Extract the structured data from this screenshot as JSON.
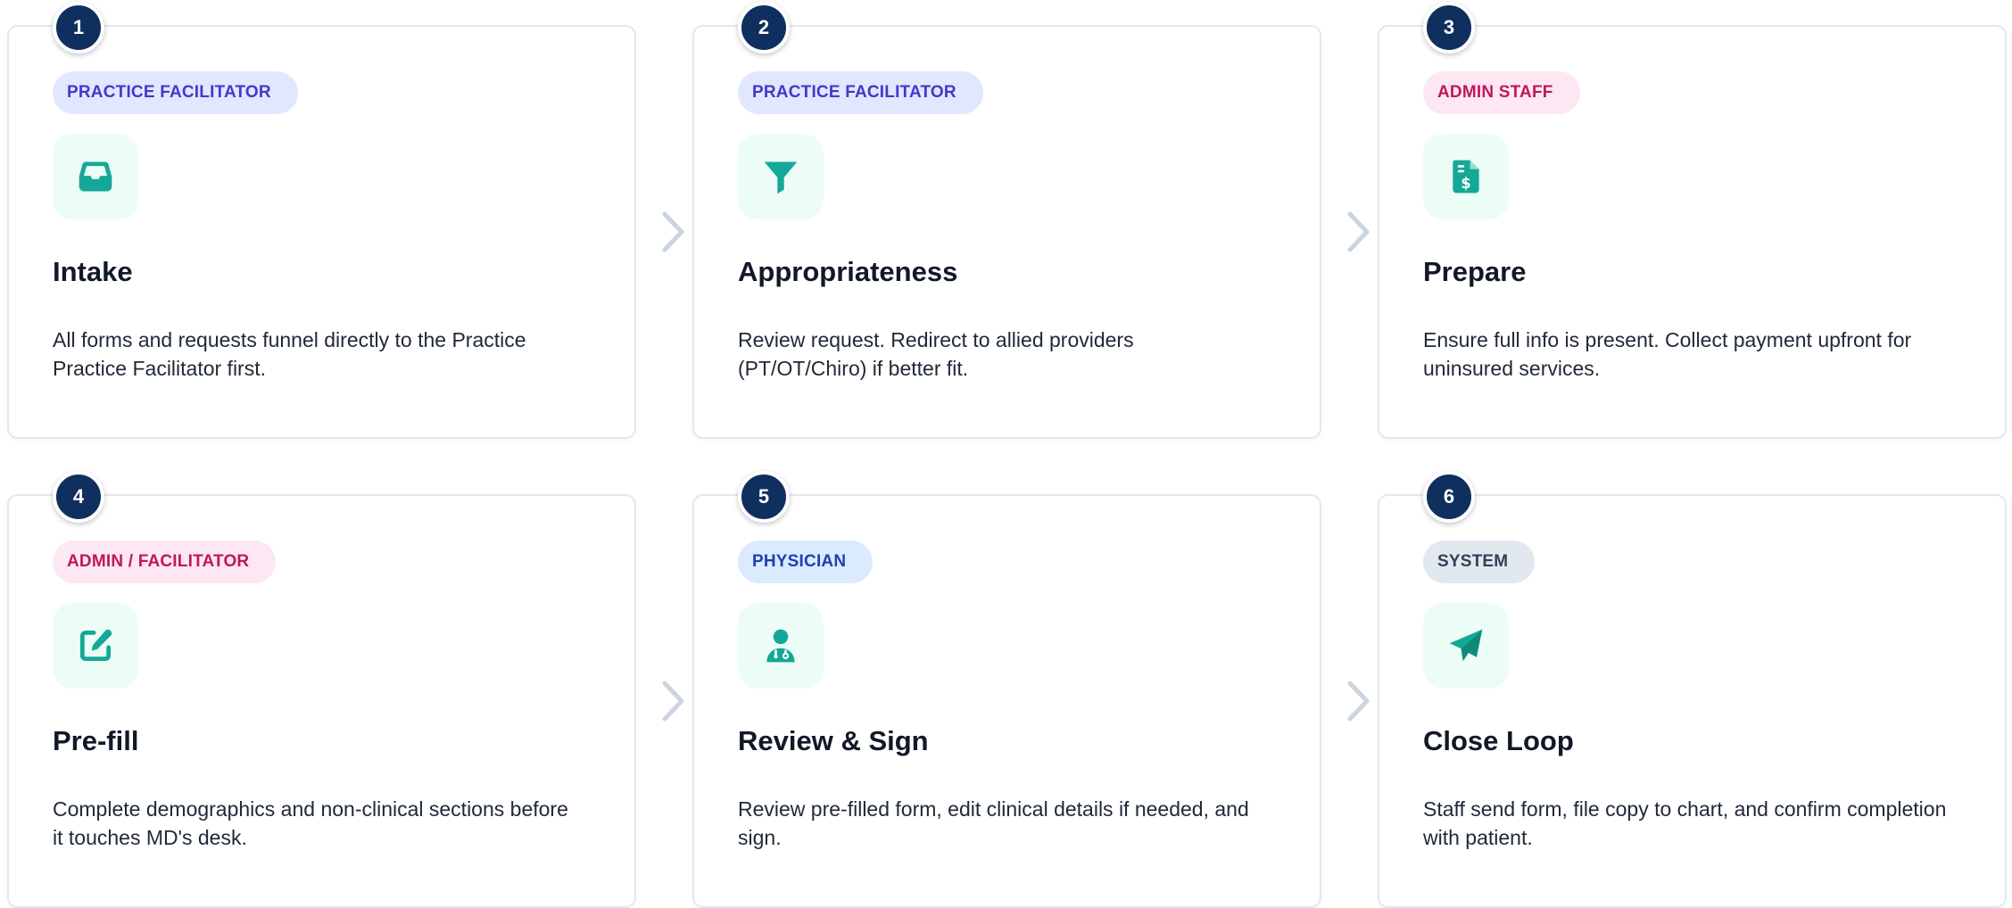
{
  "colors": {
    "number_circle": "#0f2f5f",
    "icon_teal": "#14a896",
    "icon_tile_bg": "#ecfdf8",
    "arrow": "#cbd5e1"
  },
  "steps": [
    {
      "number": "1",
      "role": "PRACTICE FACILITATOR",
      "role_style": "indigo",
      "icon": "inbox-icon",
      "title": "Intake",
      "description": "All forms and requests funnel directly to the Practice Practice Facilitator first."
    },
    {
      "number": "2",
      "role": "PRACTICE FACILITATOR",
      "role_style": "indigo",
      "icon": "filter-icon",
      "title": "Appropriateness",
      "description": "Review request. Redirect to allied providers (PT/OT/Chiro) if better fit."
    },
    {
      "number": "3",
      "role": "ADMIN STAFF",
      "role_style": "pink",
      "icon": "invoice-dollar-icon",
      "title": "Prepare",
      "description": "Ensure full info is present. Collect payment upfront for uninsured services."
    },
    {
      "number": "4",
      "role": "ADMIN / FACILITATOR",
      "role_style": "pink",
      "icon": "edit-icon",
      "title": "Pre-fill",
      "description": "Complete demographics and non-clinical sections before it touches MD's desk."
    },
    {
      "number": "5",
      "role": "PHYSICIAN",
      "role_style": "blue",
      "icon": "doctor-icon",
      "title": "Review & Sign",
      "description": "Review pre-filled form, edit clinical details if needed, and sign."
    },
    {
      "number": "6",
      "role": "SYSTEM",
      "role_style": "slate",
      "icon": "paper-plane-icon",
      "title": "Close Loop",
      "description": "Staff send form, file copy to chart, and confirm completion with patient."
    }
  ]
}
